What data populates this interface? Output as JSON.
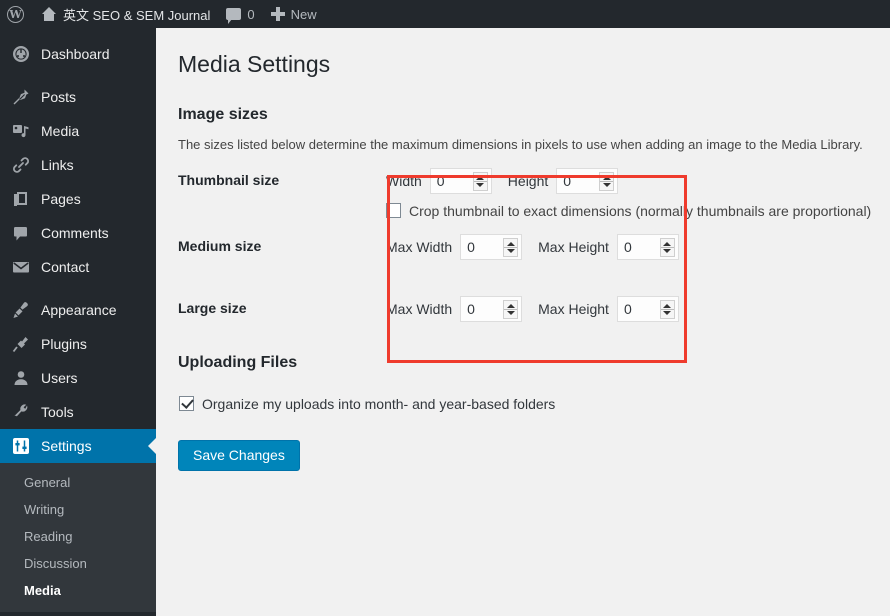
{
  "adminbar": {
    "logo_icon": "wordpress-logo-icon",
    "logo_glyph": "W",
    "home_icon": "home-icon",
    "site_title_cjk": "英文",
    "site_title_rest": " SEO & SEM Journal",
    "comment_icon": "comment-bubble-icon",
    "comment_count": "0",
    "new_icon": "plus-icon",
    "new_label": "New"
  },
  "sidebar": {
    "items": [
      {
        "label": "Dashboard",
        "icon": "dashboard-gauge-icon",
        "active": false
      },
      {
        "label": "Posts",
        "icon": "pushpin-icon",
        "active": false
      },
      {
        "label": "Media",
        "icon": "media-photo-icon",
        "active": false
      },
      {
        "label": "Links",
        "icon": "chain-link-icon",
        "active": false
      },
      {
        "label": "Pages",
        "icon": "pages-book-icon",
        "active": false
      },
      {
        "label": "Comments",
        "icon": "comment-bubble-icon",
        "active": false
      },
      {
        "label": "Contact",
        "icon": "envelope-icon",
        "active": false
      },
      {
        "label": "Appearance",
        "icon": "paintbrush-icon",
        "active": false
      },
      {
        "label": "Plugins",
        "icon": "plug-icon",
        "active": false
      },
      {
        "label": "Users",
        "icon": "user-person-icon",
        "active": false
      },
      {
        "label": "Tools",
        "icon": "wrench-icon",
        "active": false
      },
      {
        "label": "Settings",
        "icon": "settings-sliders-icon",
        "active": true
      }
    ],
    "submenu": [
      {
        "label": "General",
        "current": false
      },
      {
        "label": "Writing",
        "current": false
      },
      {
        "label": "Reading",
        "current": false
      },
      {
        "label": "Discussion",
        "current": false
      },
      {
        "label": "Media",
        "current": true
      }
    ]
  },
  "main": {
    "page_title": "Media Settings",
    "image_sizes": {
      "heading": "Image sizes",
      "description": "The sizes listed below determine the maximum dimensions in pixels to use when adding an image to the Media Library.",
      "rows": [
        {
          "label": "Thumbnail size",
          "fields": [
            {
              "label": "Width",
              "value": "0"
            },
            {
              "label": "Height",
              "value": "0"
            }
          ],
          "checkbox": {
            "label": "Crop thumbnail to exact dimensions (normally thumbnails are proportional)",
            "checked": false
          }
        },
        {
          "label": "Medium size",
          "fields": [
            {
              "label": "Max Width",
              "value": "0"
            },
            {
              "label": "Max Height",
              "value": "0"
            }
          ]
        },
        {
          "label": "Large size",
          "fields": [
            {
              "label": "Max Width",
              "value": "0"
            },
            {
              "label": "Max Height",
              "value": "0"
            }
          ]
        }
      ]
    },
    "uploading_files": {
      "heading": "Uploading Files",
      "organize_label": "Organize my uploads into month- and year-based folders",
      "organize_checked": true
    },
    "save_label": "Save Changes"
  },
  "colors": {
    "admin_bar": "#23282d",
    "sidebar": "#23282d",
    "submenu": "#32373c",
    "accent_blue": "#0073aa",
    "button_blue": "#0085ba",
    "annotation_red": "#ef3b2d",
    "content_bg": "#f1f1f1"
  }
}
